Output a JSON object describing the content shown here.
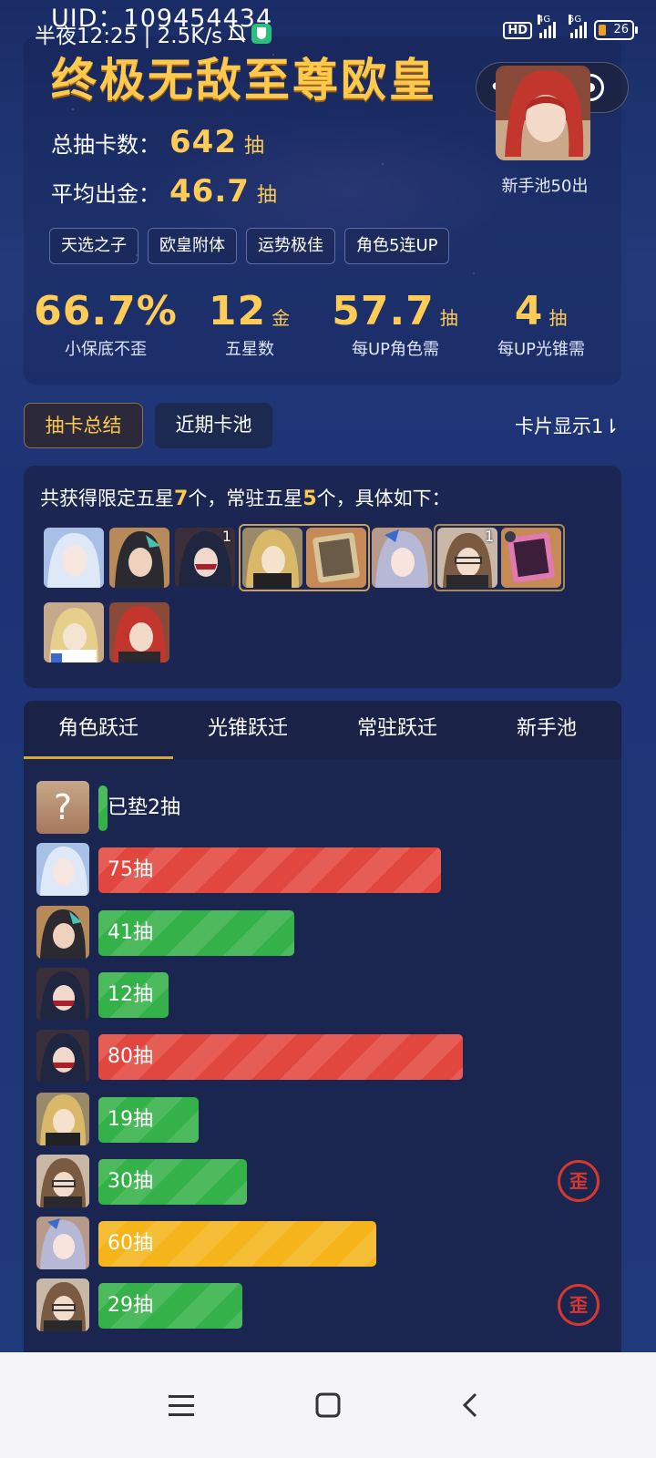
{
  "status_bar": {
    "uid": "UID：109454434",
    "time": "半夜12:25 | 2.5K/s",
    "hd": "HD",
    "net_4g": "4G",
    "net_5g": "5G",
    "battery": "26"
  },
  "summary": {
    "title": "终极无敌至尊欧皇",
    "total_label": "总抽卡数：",
    "total_value": "642",
    "total_unit": "抽",
    "avg_label": "平均出金：",
    "avg_value": "46.7",
    "avg_unit": "抽",
    "avatar_caption": "新手池50出",
    "tags": [
      "天选之子",
      "欧皇附体",
      "运势极佳",
      "角色5连UP"
    ],
    "metrics": [
      {
        "value": "66.7%",
        "unit": "",
        "label": "小保底不歪"
      },
      {
        "value": "12",
        "unit": "金",
        "label": "五星数"
      },
      {
        "value": "57.7",
        "unit": "抽",
        "label": "每UP角色需"
      },
      {
        "value": "4",
        "unit": "抽",
        "label": "每UP光锥需"
      }
    ]
  },
  "segment": {
    "active": "抽卡总结",
    "inactive": "近期卡池",
    "card_display": "卡片显示1⇂"
  },
  "obtained": {
    "prefix": "共获得限定五星",
    "limited_count": "7",
    "mid": "个，常驻五星",
    "standard_count": "5",
    "suffix": "个，具体如下：",
    "badge_a": "1",
    "badge_b": "1"
  },
  "transition_tabs": [
    "角色跃迁",
    "光锥跃迁",
    "常驻跃迁",
    "新手池"
  ],
  "rows": [
    {
      "label": "已垫2抽",
      "pulls": 2,
      "color": "green",
      "avatar": "unknown",
      "wai": false
    },
    {
      "label": "75抽",
      "pulls": 75,
      "color": "red",
      "avatar": "a1",
      "wai": false
    },
    {
      "label": "41抽",
      "pulls": 41,
      "color": "green",
      "avatar": "a2",
      "wai": false
    },
    {
      "label": "12抽",
      "pulls": 12,
      "color": "green",
      "avatar": "a3",
      "wai": false
    },
    {
      "label": "80抽",
      "pulls": 80,
      "color": "red",
      "avatar": "a3",
      "wai": false
    },
    {
      "label": "19抽",
      "pulls": 19,
      "color": "green",
      "avatar": "a4",
      "wai": false
    },
    {
      "label": "30抽",
      "pulls": 30,
      "color": "green",
      "avatar": "a5",
      "wai": true
    },
    {
      "label": "60抽",
      "pulls": 60,
      "color": "yellow",
      "avatar": "a6",
      "wai": false
    },
    {
      "label": "29抽",
      "pulls": 29,
      "color": "green",
      "avatar": "a5",
      "wai": true
    }
  ],
  "wai_text": "歪",
  "unknown_avatar_text": "?",
  "colors": {
    "accent_gold": "#ffc94d",
    "bar_red": "#e2473f",
    "bar_green": "#34b148",
    "bar_yellow": "#f5b51a"
  }
}
